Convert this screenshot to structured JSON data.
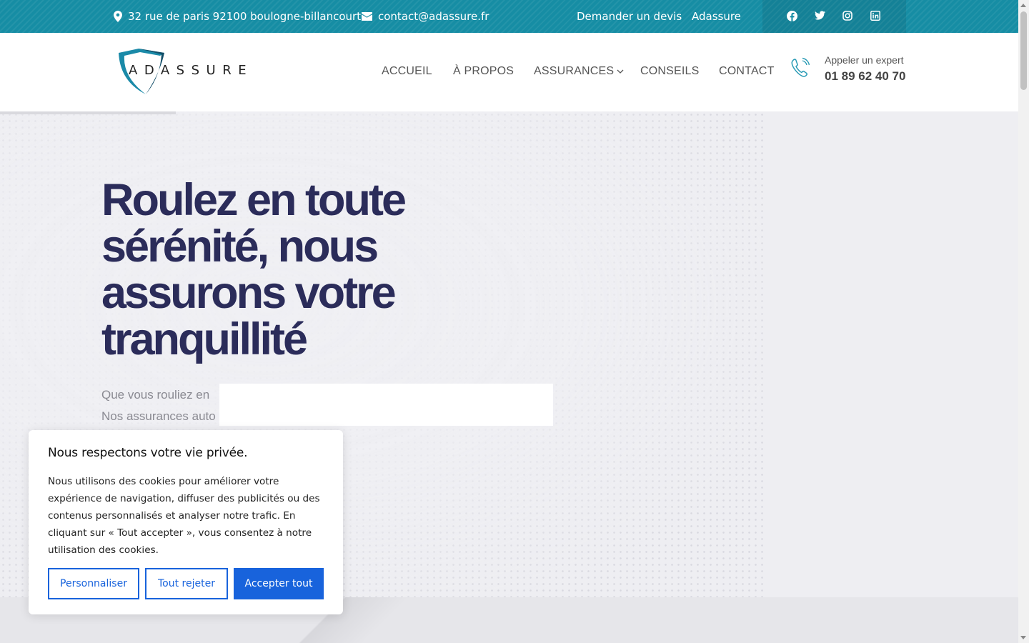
{
  "topbar": {
    "address": "32 rue de paris 92100 boulogne-billancourt",
    "email": "contact@adassure.fr",
    "quote_link": "Demander un devis",
    "brand_link": "Adassure",
    "social": [
      "facebook-icon",
      "twitter-icon",
      "instagram-icon",
      "linkedin-icon"
    ]
  },
  "header": {
    "logo_text": "ADASSURE",
    "nav": {
      "home": "ACCUEIL",
      "about": "À PROPOS",
      "insurance": "ASSURANCES",
      "advice": "CONSEILS",
      "contact": "CONTACT"
    },
    "call_label": "Appeler un expert",
    "call_number": "01 89 62 40 70"
  },
  "hero": {
    "title_lines": [
      "Roulez en toute",
      "sérénité, nous",
      "assurons votre",
      "tranquillité"
    ],
    "subtitle_lines": [
      "Que vous rouliez en",
      "Nos assurances auto"
    ]
  },
  "cookie": {
    "title": "Nous respectons votre vie privée.",
    "body": "Nous utilisons des cookies pour améliorer votre expérience de navigation, diffuser des publicités ou des contenus personnalisés et analyser notre trafic. En cliquant sur « Tout accepter », vous consentez à notre utilisation des cookies.",
    "customize": "Personnaliser",
    "reject": "Tout rejeter",
    "accept": "Accepter tout"
  },
  "colors": {
    "topbar": "#168da4",
    "title": "#2b2c5a",
    "cookie_accent": "#1863dc"
  }
}
